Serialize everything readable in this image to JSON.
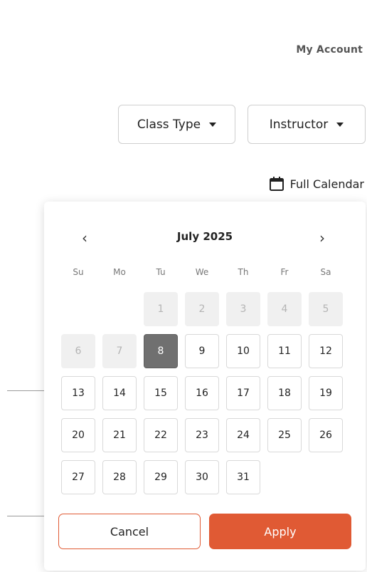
{
  "header": {
    "account_label": "My Account"
  },
  "filters": {
    "class_type_label": "Class Type",
    "instructor_label": "Instructor"
  },
  "links": {
    "full_calendar_label": "Full Calendar"
  },
  "datepicker": {
    "month_title": "July 2025",
    "prev_icon": "‹",
    "next_icon": "›",
    "weekdays": [
      "Su",
      "Mo",
      "Tu",
      "We",
      "Th",
      "Fr",
      "Sa"
    ],
    "days": [
      "1",
      "2",
      "3",
      "4",
      "5",
      "6",
      "7",
      "8",
      "9",
      "10",
      "11",
      "12",
      "13",
      "14",
      "15",
      "16",
      "17",
      "18",
      "19",
      "20",
      "21",
      "22",
      "23",
      "24",
      "25",
      "26",
      "27",
      "28",
      "29",
      "30",
      "31"
    ],
    "selected_day": "8",
    "cancel_label": "Cancel",
    "apply_label": "Apply"
  },
  "colors": {
    "accent": "#e05a34",
    "selected_day_bg": "#707070",
    "disabled_day_bg": "#f0f0f0"
  },
  "icons": {
    "calendar": "calendar-icon",
    "caret": "caret-down-icon",
    "prev": "chevron-left-icon",
    "next": "chevron-right-icon"
  }
}
